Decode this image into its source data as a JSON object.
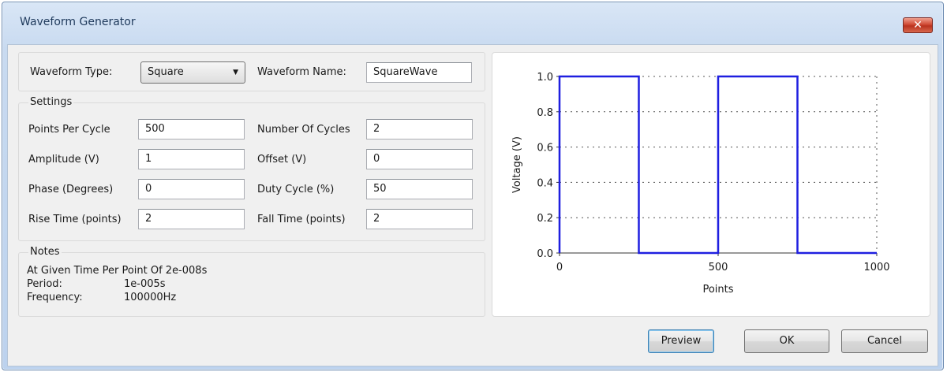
{
  "window": {
    "title": "Waveform Generator",
    "close_glyph": "✕"
  },
  "waveform": {
    "type_label": "Waveform Type:",
    "type_value": "Square",
    "name_label": "Waveform Name:",
    "name_value": "SquareWave"
  },
  "settings": {
    "title": "Settings",
    "fields": [
      {
        "label": "Points Per Cycle",
        "value": "500"
      },
      {
        "label": "Number Of Cycles",
        "value": "2"
      },
      {
        "label": "Amplitude (V)",
        "value": "1"
      },
      {
        "label": "Offset (V)",
        "value": "0"
      },
      {
        "label": "Phase (Degrees)",
        "value": "0"
      },
      {
        "label": "Duty Cycle (%)",
        "value": "50"
      },
      {
        "label": "Rise Time (points)",
        "value": "2"
      },
      {
        "label": "Fall Time (points)",
        "value": "2"
      }
    ]
  },
  "notes": {
    "title": "Notes",
    "line1": "At Given Time Per Point Of 2e-008s",
    "period_label": "Period:",
    "period_value": "1e-005s",
    "frequency_label": "Frequency:",
    "frequency_value": "100000Hz"
  },
  "buttons": {
    "preview": "Preview",
    "ok": "OK",
    "cancel": "Cancel"
  },
  "icons": {
    "close": "close-icon",
    "dropdown": "chevron-down-icon"
  },
  "colors": {
    "series": "#1f1fe0",
    "close_button": "#c8402a"
  },
  "chart_data": {
    "type": "line",
    "title": "",
    "xlabel": "Points",
    "ylabel": "Voltage (V)",
    "xlim": [
      0,
      1000
    ],
    "ylim": [
      0,
      1
    ],
    "x_ticks": [
      "0",
      "500",
      "1000"
    ],
    "y_ticks": [
      "0.0",
      "0.2",
      "0.4",
      "0.6",
      "0.8",
      "1.0"
    ],
    "grid": true,
    "series": [
      {
        "x": [
          0,
          0,
          250,
          250,
          500,
          500,
          750,
          750,
          1000
        ],
        "y": [
          0,
          1,
          1,
          0,
          0,
          1,
          1,
          0,
          0
        ]
      }
    ]
  }
}
